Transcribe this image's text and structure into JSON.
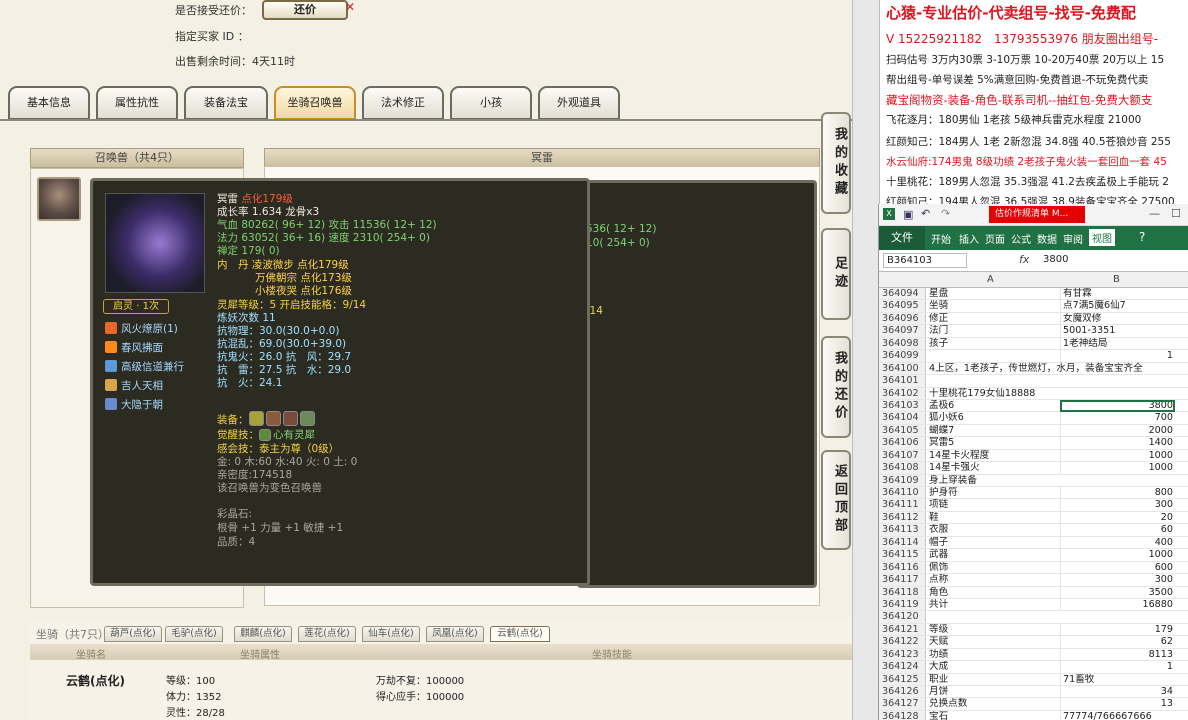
{
  "top": {
    "accept_label": "是否接受还价：",
    "counter_label": "还价",
    "buyer_label": "指定买家 ID ：",
    "remain_label": "出售剩余时间：",
    "remain_value": "4天11时"
  },
  "tabs": [
    "基本信息",
    "属性抗性",
    "装备法宝",
    "坐骑召唤兽",
    "法术修正",
    "小孩",
    "外观道具"
  ],
  "summon_header": "召唤兽（共4只）",
  "right_header": "冥雷",
  "side_buttons": [
    "我的收藏",
    "足迹",
    "我的还价",
    "返回顶部"
  ],
  "back_tip": {
    "line1": "536( 12+ 12)",
    "line2": "10( 254+ 0)",
    "line3": "/14"
  },
  "pet": {
    "name": "冥雷",
    "name_tag": " 点化179级",
    "growth": "成长率 1.634 龙骨x3",
    "hp": "气血 80262( 96+ 12) 攻击 11536( 12+ 12)",
    "mp": "法力 63052( 36+ 16) 速度 2310( 254+ 0)",
    "zen": "禅定 179( 0)",
    "core1": "内　丹 凌波微步 点化179级",
    "core2": "万佛朝宗 点化173级",
    "core3": "小楼夜哭 点化176级",
    "lingxi": "灵犀等级：5 开启技能格：9/14",
    "lianyao": "炼妖次数 11",
    "r1": "抗物理：30.0(30.0+0.0)",
    "r2": "抗混乱：69.0(30.0+39.0)",
    "r3": "抗鬼火：26.0 抗　风：29.7",
    "r4": "抗　雷：27.5 抗　水：29.0",
    "r5": "抗　火：24.1",
    "spirit": "启灵 · 1次",
    "skills": [
      "风火燎原(1)",
      "春风拂面",
      "高级信道兼行",
      "吉人天相",
      "大隐于朝"
    ],
    "equip": "装备：",
    "awaken": "觉醒技：",
    "awaken_v": "心有灵犀",
    "sense": "感会技：",
    "sense_v": "泰主为尊（0级）",
    "elements": "金: 0 木:60 水:40 火: 0 土: 0",
    "intimacy": "亲密度:174518",
    "color_note": "该召唤兽为变色召唤兽",
    "crystal": "彩晶石:",
    "crystal_v": "根骨 +1 力量 +1 敏捷 +1",
    "quality": "品质：4"
  },
  "mount": {
    "header": "坐骑（共7只）",
    "tabs": [
      "葫芦(点化)",
      "毛驴(点化)",
      "麒麟(点化)",
      "莲花(点化)",
      "仙车(点化)",
      "凤凰(点化)",
      "云鹤(点化)"
    ],
    "cols": [
      "坐骑名",
      "坐骑属性",
      "坐骑技能"
    ],
    "name": "云鹤(点化)",
    "level": "等级：100",
    "stamina": "体力：1352",
    "spirit": "灵性：28/28",
    "sk1": "万劫不复：100000",
    "sk2": "得心应手：100000"
  },
  "promo": [
    {
      "t": "心猿-专业估价-代卖组号-找号-免费配",
      "c": "#e0141e",
      "s": 15
    },
    {
      "t": "V 15225921182　13793553976 朋友圈出组号-",
      "c": "#e0141e",
      "s": 12
    },
    {
      "t": "扫码估号 3万内30票 3-10万票 10-20万40票 20万以上 15",
      "c": "#222",
      "s": 10.5
    },
    {
      "t": "帮出组号-单号误差 5%满意回购-免费首退-不玩免费代卖",
      "c": "#222",
      "s": 10.5
    },
    {
      "t": "藏宝阁物资-装备-角色-联系司机--抽红包-免费大额支",
      "c": "#e0141e",
      "s": 11.5
    },
    {
      "t": "飞花逐月：180男仙 1老孩 5级神兵雷克水程度 21000",
      "c": "#222",
      "s": 10.5
    },
    {
      "t": "红颜知己：184男人 1老 2新忽混 34.8强 40.5苍狼炒音 255",
      "c": "#222",
      "s": 10.5
    },
    {
      "t": "水云仙府:174男鬼 8级功绩 2老孩子鬼火装一套回血一套 45",
      "c": "#e0141e",
      "s": 10.5
    },
    {
      "t": "十里桃花：189男人忽混 35.3强混 41.2去疾孟极上手能玩 2",
      "c": "#222",
      "s": 10.5
    },
    {
      "t": "红颜知己：194男人忽混 36.5强混 38.9装备宝宝齐全 27500",
      "c": "#222",
      "s": 10.5
    }
  ],
  "excel": {
    "title": "估价作规清单 M...",
    "ribbon": [
      "文件",
      "开始",
      "插入",
      "页面",
      "公式",
      "数据",
      "审阅",
      "视图"
    ],
    "cell_ref": "B364103",
    "fx": "fx",
    "cell_val": "3800",
    "col_a": "A",
    "col_b": "B",
    "rows": [
      [
        "364094",
        "星盘",
        "有甘霖"
      ],
      [
        "364095",
        "坐骑",
        "点7满5魔6仙7"
      ],
      [
        "364096",
        "修正",
        "女魔双修"
      ],
      [
        "364097",
        "法门",
        "5001-3351"
      ],
      [
        "364098",
        "孩子",
        "1老神结局"
      ],
      [
        "364099",
        "",
        "1"
      ],
      [
        "364100",
        "4上区，1老孩子，传世燃灯，水月，装备宝宝齐全",
        ""
      ],
      [
        "364101",
        "",
        ""
      ],
      [
        "364102",
        "十里桃花179女仙18888",
        ""
      ],
      [
        "364103",
        "孟极6",
        "3800"
      ],
      [
        "364104",
        "狐小妖6",
        "700"
      ],
      [
        "364105",
        "蝴蝶7",
        "2000"
      ],
      [
        "364106",
        "冥雷5",
        "1400"
      ],
      [
        "364107",
        "14星卡火程度",
        "1000"
      ],
      [
        "364108",
        "14星卡强火",
        "1000"
      ],
      [
        "364109",
        "身上穿装备",
        ""
      ],
      [
        "364110",
        "护身符",
        "800"
      ],
      [
        "364111",
        "项链",
        "300"
      ],
      [
        "364112",
        "鞋",
        "20"
      ],
      [
        "364113",
        "衣服",
        "60"
      ],
      [
        "364114",
        "帽子",
        "400"
      ],
      [
        "364115",
        "武器",
        "1000"
      ],
      [
        "364116",
        "佩饰",
        "600"
      ],
      [
        "364117",
        "点称",
        "300"
      ],
      [
        "364118",
        "角色",
        "3500"
      ],
      [
        "364119",
        "共计",
        "16880"
      ],
      [
        "364120",
        "",
        ""
      ],
      [
        "364121",
        "等级",
        "179"
      ],
      [
        "364122",
        "天赋",
        "62"
      ],
      [
        "364123",
        "功绩",
        "8113"
      ],
      [
        "364124",
        "大成",
        "1"
      ],
      [
        "364125",
        "职业",
        "71畜牧"
      ],
      [
        "364126",
        "月饼",
        "34"
      ],
      [
        "364127",
        "兑换点数",
        "13"
      ],
      [
        "364128",
        "宝石",
        "77774/766667666"
      ]
    ]
  },
  "colors": {
    "accent": "#c98c2a",
    "tip_bg": "#2c2b22",
    "excel_green": "#207245",
    "promo_red": "#e0141e"
  }
}
